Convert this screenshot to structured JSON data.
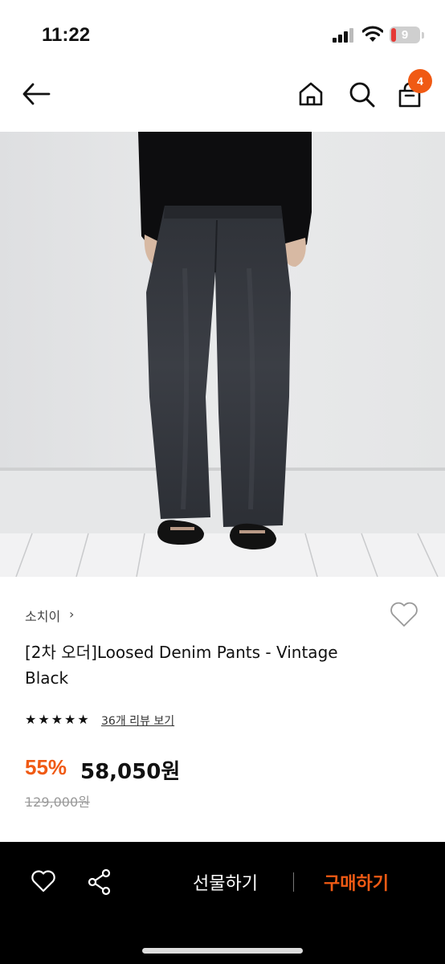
{
  "status_bar": {
    "time": "11:22",
    "battery_level": "9",
    "icons": [
      "signal-icon",
      "wifi-icon",
      "battery-icon"
    ]
  },
  "nav": {
    "icons": [
      "back-arrow-icon",
      "home-icon",
      "search-icon",
      "cart-icon"
    ],
    "cart_count": "4"
  },
  "product": {
    "brand": "소치이",
    "brand_chevron": "›",
    "title": "[2차 오더]Loosed Denim Pants - Vintage Black",
    "rating_stars": 5,
    "reviews_link": "36개 리뷰 보기",
    "discount": "55%",
    "price": "58,050원",
    "original_price": "129,000원",
    "image": "denim-pants-photo"
  },
  "bottom_bar": {
    "icons": [
      "heart-icon",
      "share-icon"
    ],
    "gift_label": "선물하기",
    "buy_label": "구매하기"
  },
  "colors": {
    "accent": "#f05a14",
    "bottom_bar_bg": "#000000"
  }
}
